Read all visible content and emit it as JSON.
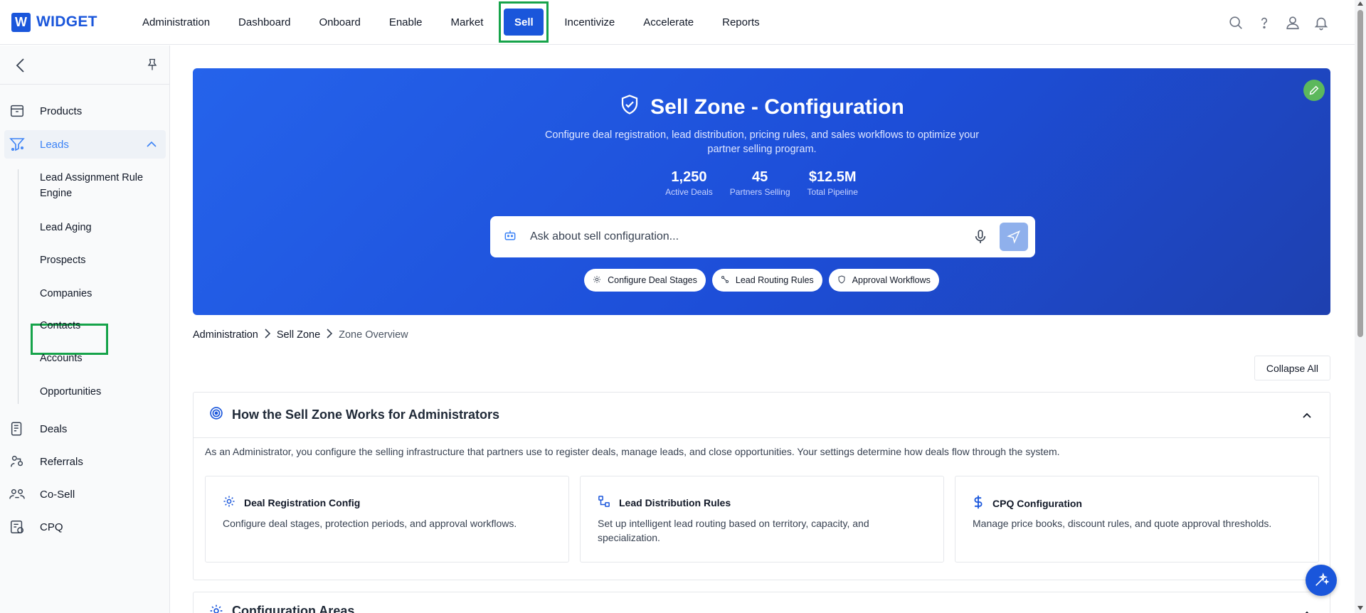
{
  "app": {
    "logo_letter": "W",
    "logo_text": "WIDGET"
  },
  "nav": {
    "items": [
      "Administration",
      "Dashboard",
      "Onboard",
      "Enable",
      "Market",
      "Sell",
      "Incentivize",
      "Accelerate",
      "Reports"
    ],
    "active": "Sell"
  },
  "top_icons": [
    "search-icon",
    "help-icon",
    "user-icon",
    "bell-icon"
  ],
  "sidebar": {
    "items": [
      {
        "label": "Products",
        "icon": "box-icon"
      },
      {
        "label": "Leads",
        "icon": "funnel-icon",
        "expanded": true
      },
      {
        "label": "Deals",
        "icon": "document-dollar-icon"
      },
      {
        "label": "Referrals",
        "icon": "referrals-icon"
      },
      {
        "label": "Co-Sell",
        "icon": "co-sell-icon"
      },
      {
        "label": "CPQ",
        "icon": "cpq-icon"
      }
    ],
    "lead_subitems": [
      "Lead Assignment Rule Engine",
      "Lead Aging",
      "Prospects",
      "Companies",
      "Contacts",
      "Accounts",
      "Opportunities"
    ]
  },
  "hero": {
    "title": "Sell Zone - Configuration",
    "subtitle": "Configure deal registration, lead distribution, pricing rules, and sales workflows to optimize your partner selling program.",
    "stats": [
      {
        "value": "1,250",
        "label": "Active Deals"
      },
      {
        "value": "45",
        "label": "Partners Selling"
      },
      {
        "value": "$12.5M",
        "label": "Total Pipeline"
      }
    ],
    "ask_placeholder": "Ask about sell configuration...",
    "chips": [
      "Configure Deal Stages",
      "Lead Routing Rules",
      "Approval Workflows"
    ]
  },
  "breadcrumb": [
    "Administration",
    "Sell Zone",
    "Zone Overview"
  ],
  "collapse_all": "Collapse All",
  "how_panel": {
    "title": "How the Sell Zone Works for Administrators",
    "description": "As an Administrator, you configure the selling infrastructure that partners use to register deals, manage leads, and close opportunities. Your settings determine how deals flow through the system.",
    "cards": [
      {
        "title": "Deal Registration Config",
        "desc": "Configure deal stages, protection periods, and approval workflows.",
        "icon": "gear-icon"
      },
      {
        "title": "Lead Distribution Rules",
        "desc": "Set up intelligent lead routing based on territory, capacity, and specialization.",
        "icon": "routing-icon"
      },
      {
        "title": "CPQ Configuration",
        "desc": "Manage price books, discount rules, and quote approval thresholds.",
        "icon": "dollar-icon"
      }
    ]
  },
  "config_panel": {
    "title": "Configuration Areas"
  },
  "colors": {
    "brand": "#1a56db",
    "highlight": "#16a34a",
    "hero_start": "#2563eb",
    "hero_end": "#1e40af",
    "leads_active": "#3b82f6"
  }
}
